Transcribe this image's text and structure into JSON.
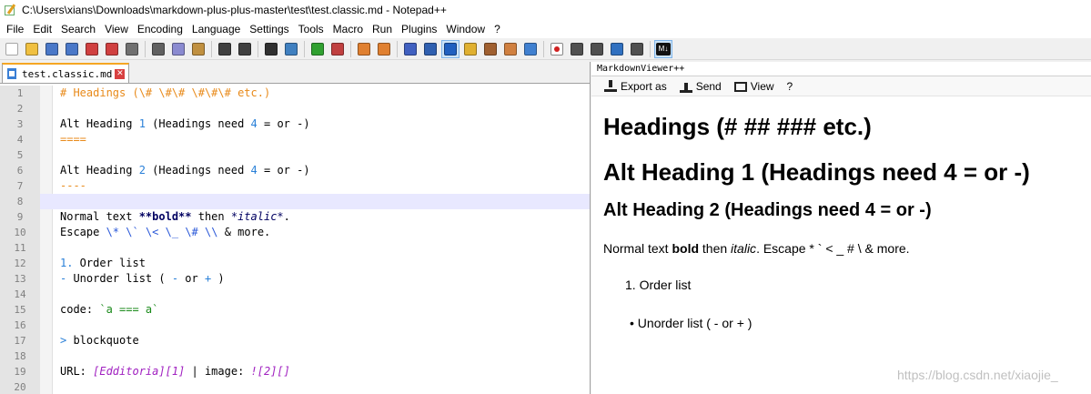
{
  "window": {
    "title": "C:\\Users\\xians\\Downloads\\markdown-plus-plus-master\\test\\test.classic.md - Notepad++"
  },
  "menu": [
    "File",
    "Edit",
    "Search",
    "View",
    "Encoding",
    "Language",
    "Settings",
    "Tools",
    "Macro",
    "Run",
    "Plugins",
    "Window",
    "?"
  ],
  "toolbar": {
    "groups": [
      [
        "new-icon",
        "open-icon",
        "save-icon",
        "save-all-icon",
        "close-icon",
        "close-all-icon",
        "print-icon"
      ],
      [
        "cut-icon",
        "copy-icon",
        "paste-icon"
      ],
      [
        "undo-icon",
        "redo-icon"
      ],
      [
        "find-icon",
        "replace-icon"
      ],
      [
        "zoom-in-icon",
        "zoom-out-icon"
      ],
      [
        "sync-vertical-icon",
        "sync-horizontal-icon"
      ],
      [
        "word-wrap-icon",
        "show-all-chars-icon",
        "indent-guide-icon",
        "doc-map-icon",
        "function-list-icon",
        "folder-workspace-icon",
        "monitor-icon"
      ],
      [
        "record-macro-icon",
        "stop-record-icon",
        "play-macro-icon",
        "run-macro-multiple-icon",
        "save-macro-icon"
      ],
      [
        "markdown-viewer-icon"
      ]
    ],
    "active": [
      "indent-guide-icon",
      "markdown-viewer-icon"
    ],
    "markdown_label": "M↓"
  },
  "editor": {
    "tab": {
      "label": "test.classic.md",
      "close_glyph": "✕"
    },
    "current_line": 8,
    "lines": [
      {
        "n": "1",
        "parts": [
          [
            "h",
            "# Headings (\\# \\#\\# \\#\\#\\# etc.)"
          ]
        ]
      },
      {
        "n": "2",
        "parts": []
      },
      {
        "n": "3",
        "parts": [
          [
            "n",
            "Alt Heading "
          ],
          [
            "num",
            "1"
          ],
          [
            "n",
            " (Headings need "
          ],
          [
            "num",
            "4"
          ],
          [
            "n",
            " = or -)"
          ]
        ]
      },
      {
        "n": "4",
        "parts": [
          [
            "h",
            "===="
          ]
        ]
      },
      {
        "n": "5",
        "parts": []
      },
      {
        "n": "6",
        "parts": [
          [
            "n",
            "Alt Heading "
          ],
          [
            "num",
            "2"
          ],
          [
            "n",
            " (Headings need "
          ],
          [
            "num",
            "4"
          ],
          [
            "n",
            " = or -)"
          ]
        ]
      },
      {
        "n": "7",
        "parts": [
          [
            "h",
            "----"
          ]
        ]
      },
      {
        "n": "8",
        "parts": []
      },
      {
        "n": "9",
        "parts": [
          [
            "n",
            "Normal text "
          ],
          [
            "bold",
            "**bold**"
          ],
          [
            "n",
            " then "
          ],
          [
            "ital",
            "*italic*"
          ],
          [
            "n",
            "."
          ]
        ]
      },
      {
        "n": "10",
        "parts": [
          [
            "n",
            "Escape "
          ],
          [
            "esc",
            "\\*"
          ],
          [
            "n",
            " "
          ],
          [
            "esc",
            "\\`"
          ],
          [
            "n",
            " "
          ],
          [
            "esc",
            "\\<"
          ],
          [
            "n",
            " "
          ],
          [
            "esc",
            "\\_"
          ],
          [
            "n",
            " "
          ],
          [
            "esc",
            "\\#"
          ],
          [
            "n",
            " "
          ],
          [
            "esc",
            "\\\\"
          ],
          [
            "n",
            " & more."
          ]
        ]
      },
      {
        "n": "11",
        "parts": []
      },
      {
        "n": "12",
        "parts": [
          [
            "list",
            "1."
          ],
          [
            "n",
            " Order list"
          ]
        ]
      },
      {
        "n": "13",
        "parts": [
          [
            "list",
            "-"
          ],
          [
            "n",
            " Unorder list ( "
          ],
          [
            "list",
            "-"
          ],
          [
            "n",
            " or "
          ],
          [
            "list",
            "+"
          ],
          [
            "n",
            " )"
          ]
        ]
      },
      {
        "n": "14",
        "parts": []
      },
      {
        "n": "15",
        "parts": [
          [
            "n",
            "code: "
          ],
          [
            "code",
            "`a === a`"
          ]
        ]
      },
      {
        "n": "16",
        "parts": []
      },
      {
        "n": "17",
        "parts": [
          [
            "quote",
            ">"
          ],
          [
            "n",
            " blockquote"
          ]
        ]
      },
      {
        "n": "18",
        "parts": []
      },
      {
        "n": "19",
        "parts": [
          [
            "n",
            "URL: "
          ],
          [
            "link",
            "[Edditoria][1]"
          ],
          [
            "n",
            " | image: "
          ],
          [
            "link",
            "![2][]"
          ]
        ]
      },
      {
        "n": "20",
        "parts": []
      }
    ]
  },
  "viewer": {
    "title": "MarkdownViewer++",
    "toolbar": [
      {
        "label": "Export as",
        "icon": "export-icon"
      },
      {
        "label": "Send",
        "icon": "send-icon"
      },
      {
        "label": "View",
        "icon": "view-icon"
      },
      {
        "label": "?",
        "icon": ""
      }
    ],
    "content": {
      "h1": "Headings (# ## ### etc.)",
      "h1_alt": "Alt Heading 1 (Headings need 4 = or -)",
      "h2_alt": "Alt Heading 2 (Headings need 4 = or -)",
      "para_before_bold": "Normal text ",
      "para_bold": "bold",
      "para_mid": " then ",
      "para_italic": "italic",
      "para_after": ". Escape * ` < _ # \\ & more.",
      "ol_item": "1. Order list",
      "ul_item": "• Unorder list ( - or + )"
    }
  },
  "watermark": "https://blog.csdn.net/xiaojie_"
}
